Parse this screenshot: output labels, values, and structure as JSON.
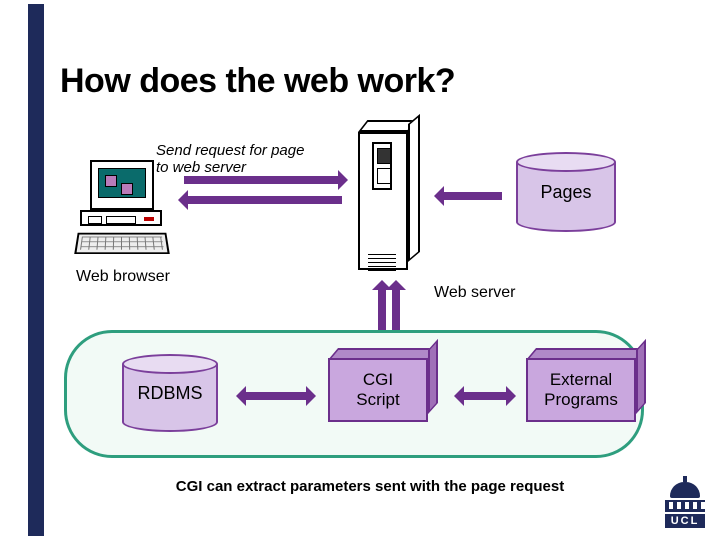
{
  "title": "How does the web work?",
  "labels": {
    "request": "Send request for page\nto web server",
    "browser": "Web browser",
    "server": "Web server",
    "pages": "Pages",
    "rdbms": "RDBMS",
    "cgi": "CGI\nScript",
    "external": "External\nPrograms"
  },
  "caption": "CGI can extract parameters sent with the page request",
  "logo_text": "UCL",
  "colors": {
    "accent_bar": "#1e2a5a",
    "arrow": "#6b2f8b",
    "group_border": "#2e9e7e",
    "box_fill": "#c9a7de",
    "cyl_fill": "#d8c5e8"
  }
}
